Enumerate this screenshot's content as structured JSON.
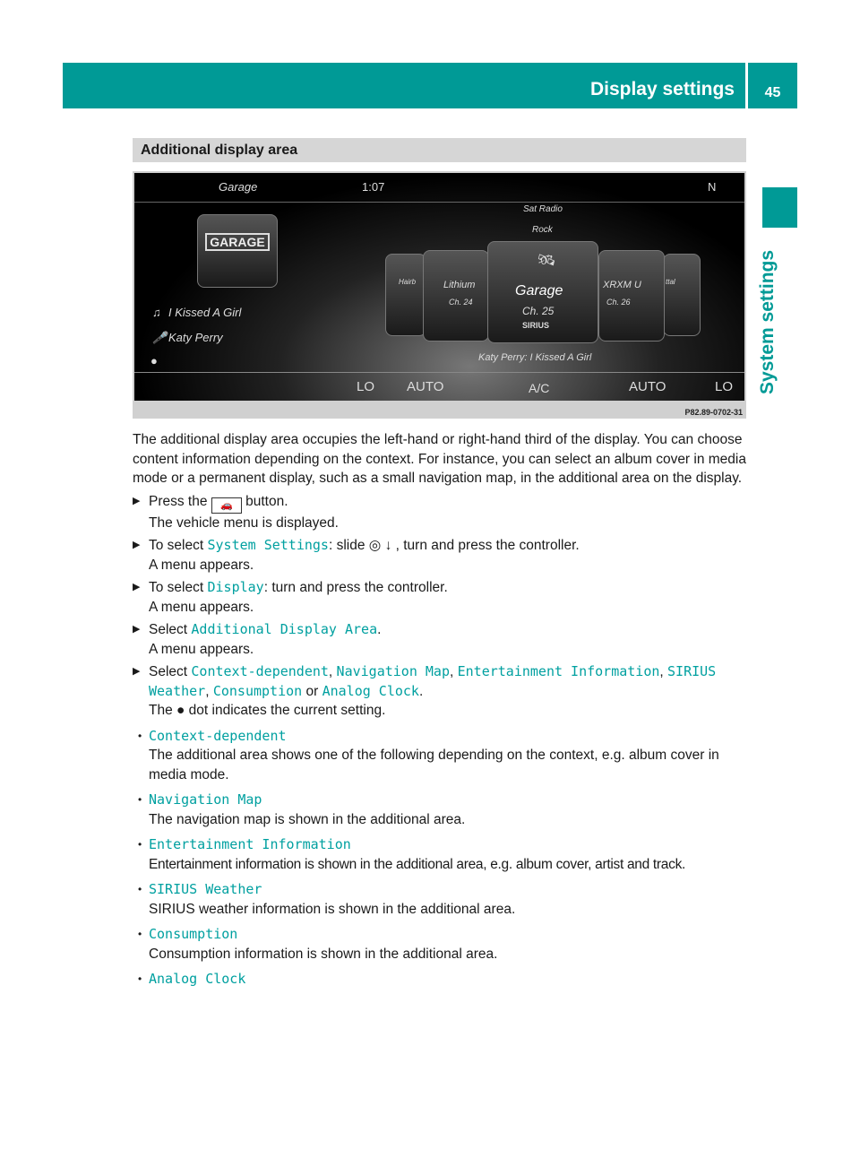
{
  "header": {
    "title": "Display settings",
    "page": "45",
    "side_tab": "System settings"
  },
  "section_title": "Additional display area",
  "screenshot": {
    "source": "Garage",
    "time": "1:07",
    "compass": "N",
    "band": "Sat Radio",
    "genre": "Rock",
    "track": "I Kissed A Girl",
    "artist": "Katy Perry",
    "center_station": "Garage",
    "center_channel": "Ch. 25",
    "center_brand": "SIRIUS",
    "left_station": "Lithium",
    "left_channel": "Ch. 24",
    "right_station": "XRXM U",
    "right_channel": "Ch. 26",
    "far_left": "Hairb",
    "far_right": "ttal",
    "now_playing": "Katy Perry: I Kissed A Girl",
    "climate": [
      "LO",
      "AUTO",
      "A/C",
      "AUTO",
      "LO"
    ],
    "caption": "P82.89-0702-31"
  },
  "intro": "The additional display area occupies the left-hand or right-hand third of the display. You can choose content information depending on the context. For instance, you can select an album cover in media mode or a permanent display, such as a small navigation map, in the additional area on the display.",
  "steps": [
    {
      "pre": "Press the",
      "post": "button.",
      "result": "The vehicle menu is displayed."
    },
    {
      "pre": "To select ",
      "code": "System Settings",
      "post": ": slide ◎ ↓ , turn and press the controller.",
      "result": "A menu appears."
    },
    {
      "pre": "To select ",
      "code": "Display",
      "post": ": turn and press the controller.",
      "result": "A menu appears."
    },
    {
      "pre": "Select ",
      "code": "Additional Display Area",
      "post": ".",
      "result": "A menu appears."
    }
  ],
  "select_step": {
    "pre": "Select ",
    "opts": [
      "Context-dependent",
      "Navigation Map",
      "Entertainment Information",
      "SIRIUS Weather",
      "Consumption",
      "Analog Clock"
    ],
    "sep": ", ",
    "or": " or ",
    "end": ".",
    "result": "The ● dot indicates the current setting."
  },
  "options": [
    {
      "name": "Context-dependent",
      "desc": "The additional area shows one of the following depending on the context, e.g. album cover in media mode."
    },
    {
      "name": "Navigation Map",
      "desc": "The navigation map is shown in the additional area."
    },
    {
      "name": "Entertainment Information",
      "desc": "Entertainment information is shown in the additional area, e.g. album cover, artist and track."
    },
    {
      "name": "SIRIUS Weather",
      "desc": "SIRIUS weather information is shown in the additional area."
    },
    {
      "name": "Consumption",
      "desc": "Consumption information is shown in the additional area."
    },
    {
      "name": "Analog Clock"
    }
  ],
  "colors": {
    "accent": "#009a96"
  }
}
